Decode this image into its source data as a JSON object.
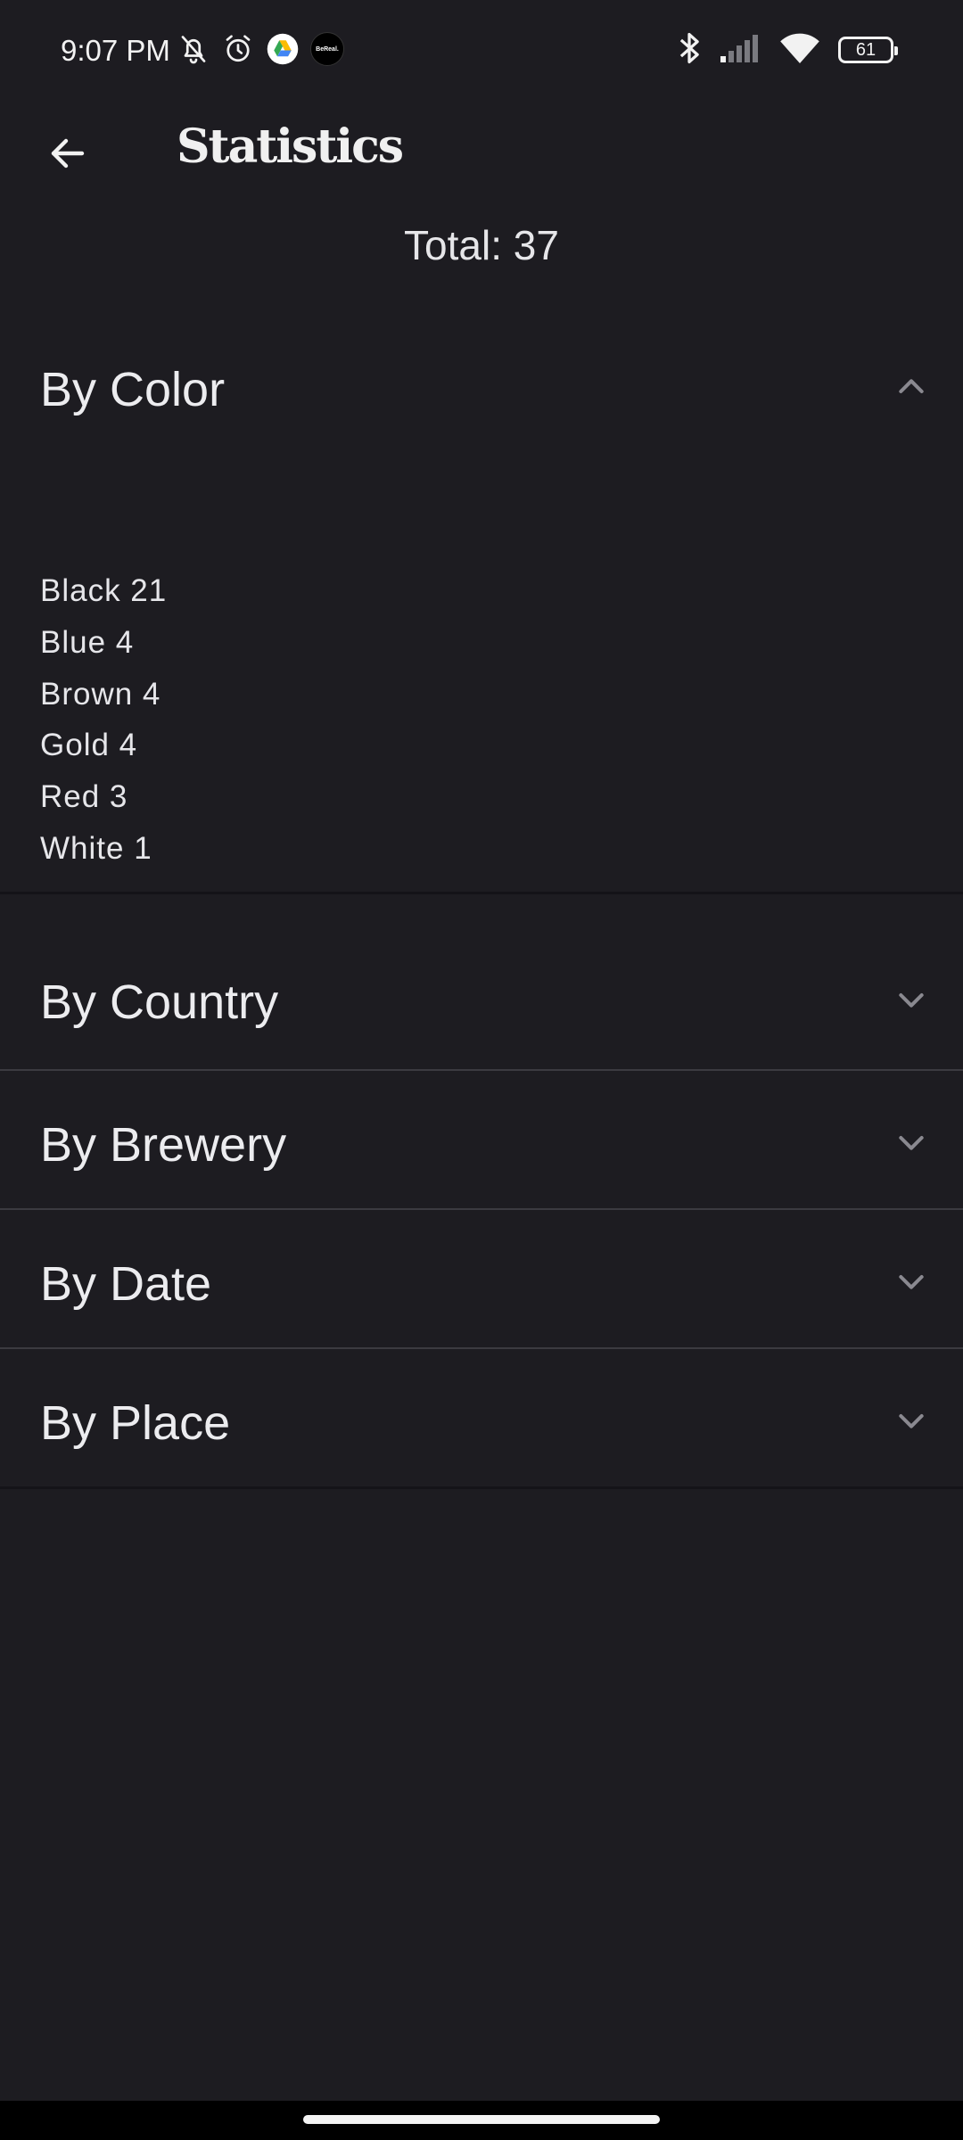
{
  "status_bar": {
    "time": "9:07 PM",
    "left_icons": [
      "bell-muted-icon",
      "alarm-icon",
      "drive-icon",
      "bereal-icon"
    ],
    "bereal_label": "BeReal.",
    "right_icons": [
      "bluetooth-icon",
      "signal-icon",
      "wifi-icon",
      "battery-icon"
    ],
    "battery_level": "61"
  },
  "app_bar": {
    "back_icon": "arrow-left-icon",
    "title": "Statistics"
  },
  "summary": {
    "total": "Total: 37"
  },
  "sections": [
    {
      "title": "By Color",
      "expanded": true,
      "items": [
        "Black 21",
        "Blue 4",
        "Brown 4",
        "Gold 4",
        "Red 3",
        "White 1"
      ]
    },
    {
      "title": "By Country",
      "expanded": false
    },
    {
      "title": "By Brewery",
      "expanded": false
    },
    {
      "title": "By Date",
      "expanded": false
    },
    {
      "title": "By Place",
      "expanded": false
    }
  ],
  "colors": {
    "background": "#1d1c21",
    "text": "#e9e8ec",
    "chevron": "#8a8990",
    "divider": "#3b3a40"
  }
}
